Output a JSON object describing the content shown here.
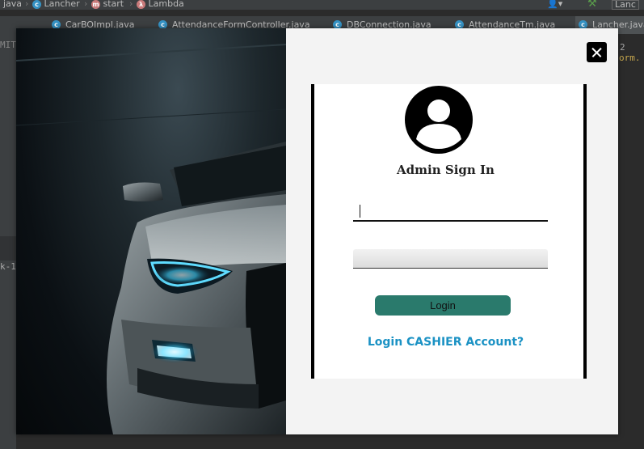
{
  "ide": {
    "breadcrumb": [
      "java",
      "Lancher",
      "start",
      "Lambda"
    ],
    "right_window_title": "Lanc",
    "tabs": [
      {
        "label": "CarBOImpl.java"
      },
      {
        "label": "AttendanceFormController.java"
      },
      {
        "label": "DBConnection.java"
      },
      {
        "label": "AttendanceTm.java"
      },
      {
        "label": "Lancher.java"
      }
    ],
    "left_fragments": {
      "top": "MITI",
      "bottom": "k-1"
    },
    "right_fragments": {
      "count": "2",
      "code": "orm."
    }
  },
  "login": {
    "title": "Admin Sign In",
    "username_value": "",
    "password_value": "",
    "button_label": "Login",
    "switch_link": "Login CASHIER Account?"
  },
  "colors": {
    "button": "#2a7a6c",
    "link": "#1b92c4",
    "modal_bg": "#f3f3f3"
  }
}
